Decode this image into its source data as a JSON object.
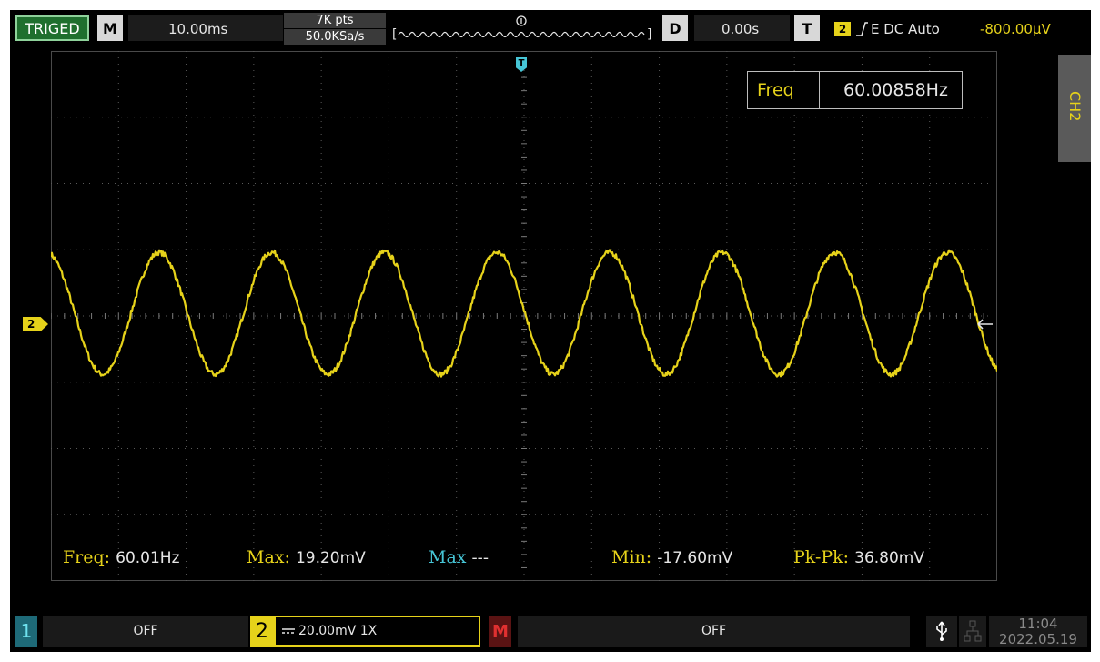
{
  "topbar": {
    "status": "TRIGED",
    "mode_button": "M",
    "timebase": "10.00ms",
    "memory_depth": "7K pts",
    "sample_rate": "50.0KSa/s",
    "delay_button": "D",
    "delay": "0.00s",
    "trigger_button": "T",
    "trigger_channel": "2",
    "trigger_info": "E DC Auto",
    "trigger_level": "-800.00μV"
  },
  "screen": {
    "channel_marker": "2",
    "trigger_marker": "T",
    "side_tab": "CH2",
    "freq_box": {
      "label": "Freq",
      "value": "60.00858Hz"
    }
  },
  "measurements": [
    {
      "label": "Freq:",
      "value": "60.01Hz",
      "label_color": "#e6d21a"
    },
    {
      "label": "Max:",
      "value": "19.20mV",
      "label_color": "#e6d21a"
    },
    {
      "label": "Max",
      "value": "---",
      "label_color": "#46c5d6"
    },
    {
      "label": "Min:",
      "value": "-17.60mV",
      "label_color": "#e6d21a"
    },
    {
      "label": "Pk-Pk:",
      "value": "36.80mV",
      "label_color": "#e6d21a"
    }
  ],
  "bottombar": {
    "ch1_number": "1",
    "ch1_state": "OFF",
    "ch2_number": "2",
    "ch2_setting": "20.00mV 1X",
    "math_button": "M",
    "math_state": "OFF",
    "time": "11:04",
    "date": "2022.05.19"
  },
  "colors": {
    "ch2": "#e6d21a",
    "ch1": "#46c5d6",
    "math": "#e03030",
    "trig_green": "#1f6f2e"
  },
  "waveform": {
    "frequency_hz": 60.00858,
    "max_mv": 19.2,
    "min_mv": -17.6,
    "volts_per_div_mv": 20.0,
    "time_per_div_ms": 10.0
  }
}
